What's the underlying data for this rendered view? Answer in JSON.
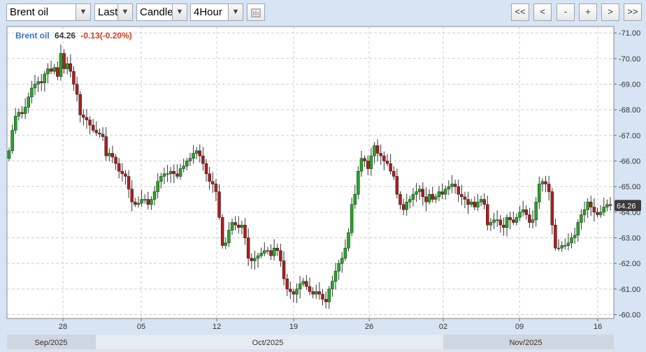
{
  "toolbar": {
    "symbol": "Brent oil",
    "price_type": "Last",
    "chart_style": "Candle",
    "interval": "4Hour",
    "nav": [
      "<<",
      "<",
      "-",
      "+",
      ">",
      ">>"
    ]
  },
  "colors": {
    "up": "#22a822",
    "down": "#b01c1c",
    "grid": "#cccccc",
    "bg": "#ffffff"
  },
  "chart_data": {
    "type": "candlestick",
    "series_name": "Brent oil",
    "last": "64.26",
    "change": "-0.13(-0.20%)",
    "ylim": [
      59.85,
      71.25
    ],
    "y_ticks": [
      "71.00",
      "70.00",
      "69.00",
      "68.00",
      "67.00",
      "66.00",
      "65.00",
      "64.00",
      "63.00",
      "62.00",
      "61.00",
      "60.00"
    ],
    "x_ticks": [
      "28",
      "05",
      "12",
      "19",
      "26",
      "02",
      "09",
      "16"
    ],
    "months": [
      "Sep/2025",
      "Oct/2025",
      "Nov/2025"
    ],
    "grid": true,
    "closes": [
      66.4,
      67.2,
      67.75,
      67.9,
      67.85,
      68.1,
      68.5,
      68.85,
      69.0,
      69.1,
      69.05,
      69.4,
      69.6,
      69.5,
      69.65,
      69.3,
      70.2,
      69.6,
      69.8,
      69.5,
      69.0,
      68.6,
      67.8,
      67.7,
      67.6,
      67.4,
      67.2,
      67.1,
      67.05,
      66.95,
      66.2,
      66.3,
      66.15,
      65.9,
      65.6,
      65.5,
      65.4,
      64.9,
      64.4,
      64.3,
      64.35,
      64.5,
      64.5,
      64.3,
      64.5,
      64.8,
      65.2,
      65.4,
      65.5,
      65.5,
      65.6,
      65.5,
      65.4,
      65.7,
      65.8,
      66.0,
      66.1,
      66.3,
      66.4,
      66.2,
      65.9,
      65.5,
      65.2,
      65.1,
      64.8,
      63.8,
      62.7,
      62.8,
      63.3,
      63.6,
      63.5,
      63.4,
      63.5,
      63.0,
      62.2,
      62.1,
      62.2,
      62.3,
      62.4,
      62.5,
      62.5,
      62.3,
      62.6,
      62.5,
      62.1,
      61.4,
      61.0,
      60.9,
      60.8,
      61.0,
      61.2,
      61.3,
      61.1,
      60.9,
      60.8,
      60.9,
      60.8,
      60.6,
      60.5,
      61.0,
      61.3,
      61.7,
      62.0,
      62.2,
      62.6,
      63.2,
      64.3,
      64.7,
      65.6,
      66.1,
      66.0,
      65.7,
      66.2,
      66.6,
      66.3,
      66.2,
      66.0,
      65.9,
      65.6,
      65.4,
      64.7,
      64.3,
      64.1,
      64.4,
      64.5,
      64.7,
      64.8,
      64.9,
      64.6,
      64.4,
      64.7,
      64.5,
      64.6,
      64.8,
      64.7,
      64.9,
      65.0,
      65.1,
      65.0,
      64.7,
      64.6,
      64.5,
      64.3,
      64.4,
      64.2,
      64.4,
      64.5,
      64.3,
      63.5,
      63.6,
      63.7,
      63.7,
      63.5,
      63.4,
      63.8,
      63.7,
      63.6,
      63.8,
      64.0,
      64.1,
      63.9,
      63.6,
      63.7,
      64.4,
      65.1,
      65.2,
      65.1,
      64.8,
      63.5,
      62.6,
      62.6,
      62.7,
      62.7,
      62.8,
      63.0,
      63.1,
      63.6,
      63.9,
      64.1,
      64.4,
      64.2,
      64.0,
      63.9,
      64.0,
      64.2,
      64.3,
      64.26
    ]
  }
}
